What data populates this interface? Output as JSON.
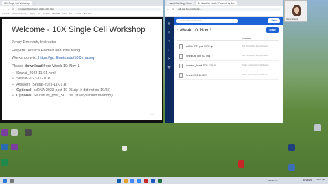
{
  "left_browser": {
    "tabs": [
      "10X Single Cell Workshop"
    ],
    "url": "C:/Users/Workshops/...2023-11-01.html",
    "bookmarks": [
      "Imported",
      "SoftwareCarpentry",
      "Flippity",
      "UI",
      "Biol 2024",
      "Biol 2024",
      "HPC",
      "Fac",
      "eLetters",
      "Biol 2024"
    ]
  },
  "slide": {
    "title": "Welcome - 10X Single Cell Workshop",
    "instructor": "Jenny Drnevich, Instructor",
    "helpers": "Helpers: Jessica Holmes and Yifei Kang",
    "wiki_prefix": "Workshop wiki: ",
    "wiki_link": "https://go.illinois.edu/10X-rnaseq",
    "download_prefix": "Please ",
    "download_bold": "download",
    "download_suffix": " from Week 10: Nov 1:",
    "files": [
      {
        "label": "",
        "text": "Seurat_2023-11-01.html"
      },
      {
        "label": "",
        "text": "Seurat-2023-11-01.R"
      },
      {
        "label": "",
        "text": "Answers_Seurat-2023-11-01.R"
      },
      {
        "label": "Optional:",
        "text": " scRNA-2023-post-10-25.zip (if did not do 10/25)"
      },
      {
        "label": "Optional:",
        "text": " SeuratObj_post_SCT.rds (if very limited memory)"
      }
    ],
    "page_number": "2/19"
  },
  "box": {
    "tabs": [
      "Launch Meeting - Zoom",
      "10 Week 10: Nov 1 | Powered by Box"
    ],
    "url": "uofi.app.box.com/folder/...",
    "search_placeholder": "Search Files and Folders",
    "new_label": "New",
    "folder_title": "Week 10: Nov 1",
    "share_label": "Share",
    "col_updated": "UPDATED",
    "files": [
      {
        "name": "scRNA-2023-post-10-25.zip",
        "date": "Oct 30, 2023 by Jenny Drnevich"
      },
      {
        "name": "SeuratObj_post_SCT.rds",
        "date": "Oct 31, 2023 by Jenny Drnevich"
      },
      {
        "name": "Answers_Seurat-2023-11-01.R",
        "date": "Today by Jenny Drnevich Zadeh"
      },
      {
        "name": "Seurat-2023-11-01.R",
        "date": "Today by Jenny Drnevich Zadeh"
      }
    ]
  },
  "webcam": {
    "name": "Jenny Drnevich"
  },
  "taskbar": {
    "weather": "53°F Sunny",
    "time": "10:07 AM",
    "date": "11/1/2023"
  }
}
